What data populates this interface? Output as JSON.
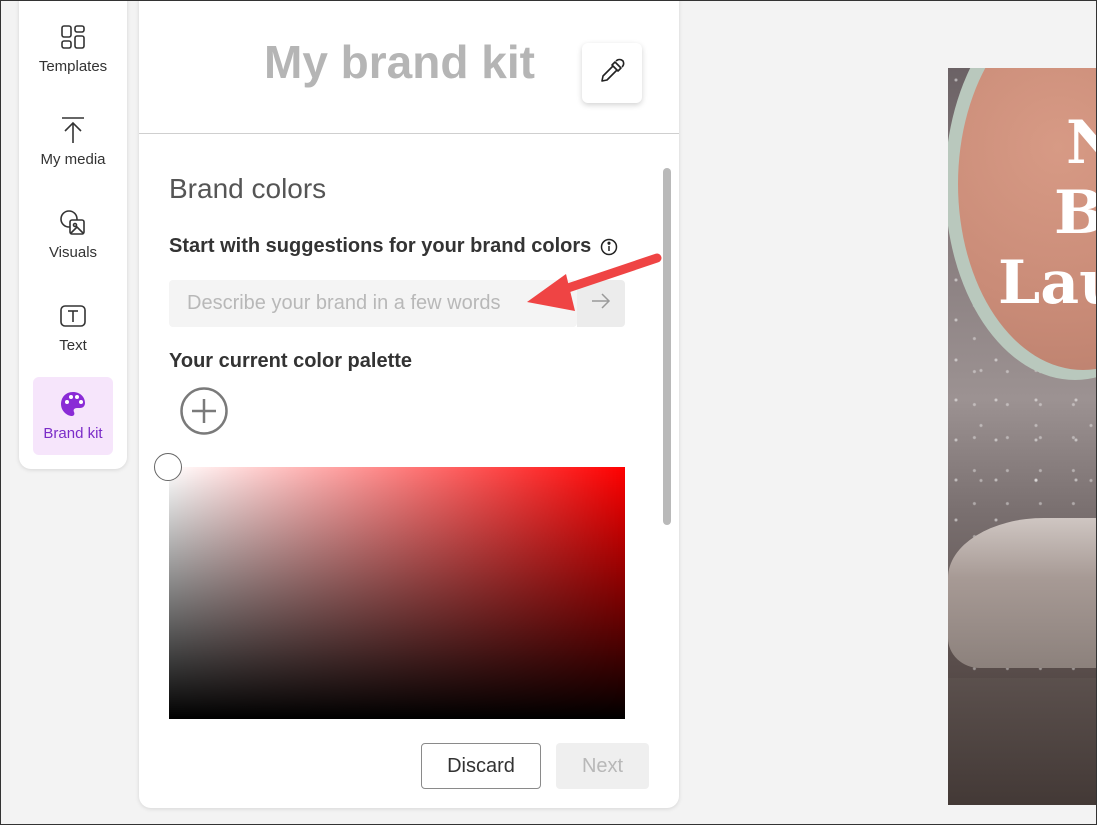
{
  "sidebar": {
    "items": [
      {
        "label": "Templates",
        "icon": "templates-icon"
      },
      {
        "label": "My media",
        "icon": "upload-icon"
      },
      {
        "label": "Visuals",
        "icon": "visuals-icon"
      },
      {
        "label": "Text",
        "icon": "text-icon"
      },
      {
        "label": "Brand kit",
        "icon": "palette-icon",
        "active": true
      }
    ]
  },
  "panel": {
    "title": "My brand kit",
    "eyedropper_icon": "eyedropper-icon",
    "section_title": "Brand colors",
    "suggest_label": "Start with suggestions for your brand colors",
    "describe_placeholder": "Describe your brand in a few words",
    "palette_label": "Your current color palette",
    "picker_hue": "#ff0000",
    "discard_label": "Discard",
    "next_label": "Next"
  },
  "preview": {
    "title_lines": [
      "N",
      "B",
      "Lau"
    ]
  },
  "colors": {
    "accent": "#7b2cc8",
    "active_bg": "#f6e5fb",
    "annotation_arrow": "#ef4444"
  }
}
